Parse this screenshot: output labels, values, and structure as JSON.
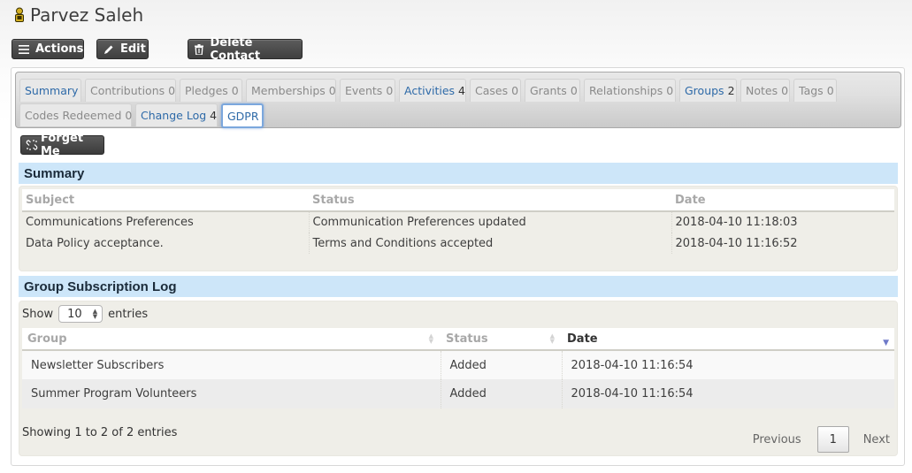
{
  "contact": {
    "name": "Parvez Saleh",
    "icon": "individual-contact-icon"
  },
  "actions": {
    "actions_label": "Actions",
    "edit_label": "Edit",
    "delete_label": "Delete Contact"
  },
  "tabs": [
    {
      "label": "Summary",
      "count": "",
      "has_items": true
    },
    {
      "label": "Contributions",
      "count": "0",
      "has_items": false
    },
    {
      "label": "Pledges",
      "count": "0",
      "has_items": false
    },
    {
      "label": "Memberships",
      "count": "0",
      "has_items": false
    },
    {
      "label": "Events",
      "count": "0",
      "has_items": false
    },
    {
      "label": "Activities",
      "count": "4",
      "has_items": true
    },
    {
      "label": "Cases",
      "count": "0",
      "has_items": false
    },
    {
      "label": "Grants",
      "count": "0",
      "has_items": false
    },
    {
      "label": "Relationships",
      "count": "0",
      "has_items": false
    },
    {
      "label": "Groups",
      "count": "2",
      "has_items": true
    },
    {
      "label": "Notes",
      "count": "0",
      "has_items": false
    },
    {
      "label": "Tags",
      "count": "0",
      "has_items": false
    },
    {
      "label": "Codes Redeemed",
      "count": "0",
      "has_items": false
    },
    {
      "label": "Change Log",
      "count": "4",
      "has_items": true
    },
    {
      "label": "GDPR",
      "count": "",
      "has_items": true,
      "active": true
    }
  ],
  "gdpr": {
    "forget_me_label": "Forget Me",
    "summary": {
      "title": "Summary",
      "columns": [
        "Subject",
        "Status",
        "Date"
      ],
      "rows": [
        [
          "Communications Preferences",
          "Communication Preferences updated",
          "2018-04-10 11:18:03"
        ],
        [
          "Data Policy acceptance.",
          "Terms and Conditions accepted",
          "2018-04-10 11:16:52"
        ]
      ]
    },
    "group_log": {
      "title": "Group Subscription Log",
      "show_label": "Show",
      "entries_label": "entries",
      "page_size": "10",
      "columns": [
        "Group",
        "Status",
        "Date"
      ],
      "sorted_column": "Date",
      "sort_direction": "descending",
      "rows": [
        [
          "Newsletter Subscribers",
          "Added",
          "2018-04-10 11:16:54"
        ],
        [
          "Summer Program Volunteers",
          "Added",
          "2018-04-10 11:16:54"
        ]
      ],
      "info": "Showing 1 to 2 of 2 entries",
      "pagination": {
        "previous_label": "Previous",
        "current_page": "1",
        "next_label": "Next"
      }
    }
  },
  "colors": {
    "link_blue": "#2e6aa8",
    "section_header_bg": "#cde6f9",
    "panel_bg": "#efeee8",
    "button_dark": "#4a4a4a",
    "sort_indicator": "#6f7ac9"
  }
}
